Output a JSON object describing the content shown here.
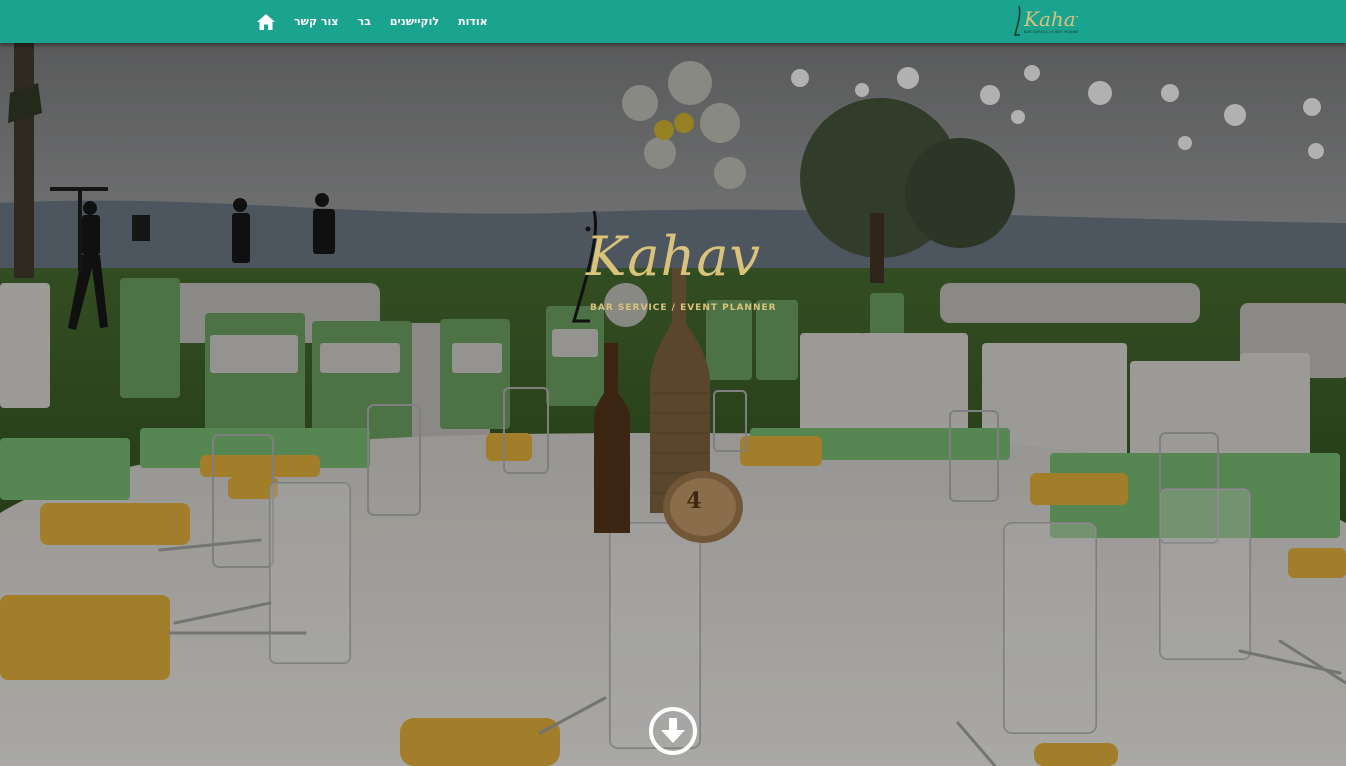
{
  "nav": {
    "items": [
      {
        "label": "צור קשר"
      },
      {
        "label": "בר"
      },
      {
        "label": "לוקיישנים"
      },
      {
        "label": "אודות"
      }
    ],
    "home_icon": "home-icon"
  },
  "brand": {
    "name": "Kahav",
    "tagline": "BAR SERVICE / EVENT PLANNER",
    "table_number": "4"
  },
  "colors": {
    "navbar": "#1aa38f",
    "logo_gold": "#d9c27a",
    "napkin": "#f2b632",
    "chair": "#8fd48a"
  },
  "scroll_icon": "arrow-down-circle-icon"
}
